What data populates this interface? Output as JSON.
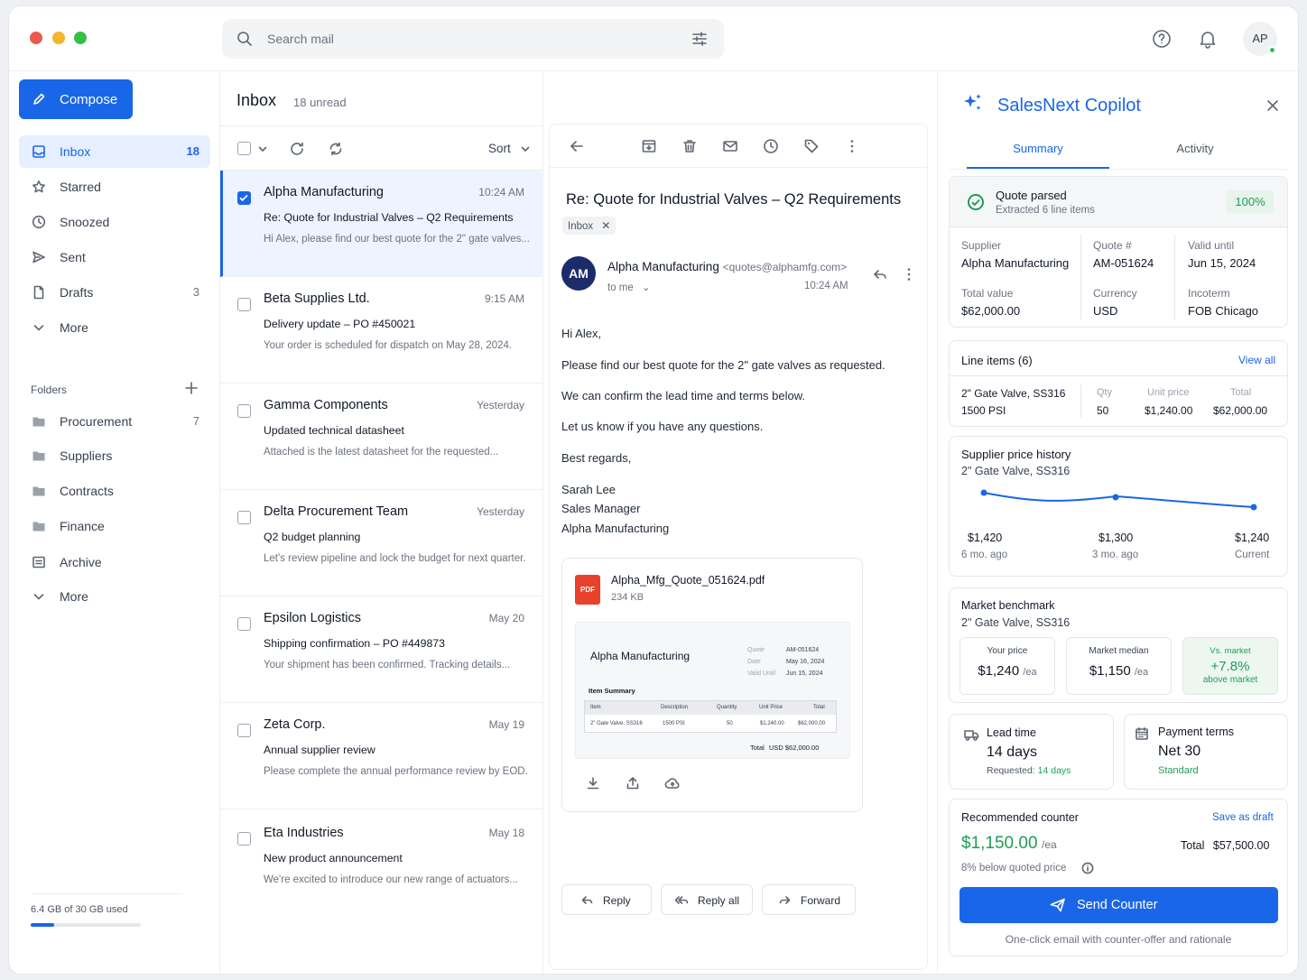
{
  "search": {
    "placeholder": "Search mail"
  },
  "user": {
    "initials": "AP"
  },
  "sidebar": {
    "compose": "Compose",
    "items": [
      {
        "label": "Inbox",
        "count": "18",
        "icon": "inbox-icon"
      },
      {
        "label": "Starred",
        "count": "",
        "icon": "star-icon"
      },
      {
        "label": "Snoozed",
        "count": "",
        "icon": "clock-icon"
      },
      {
        "label": "Sent",
        "count": "",
        "icon": "send-icon"
      },
      {
        "label": "Drafts",
        "count": "3",
        "icon": "file-icon"
      },
      {
        "label": "More",
        "count": "",
        "icon": "chevron-down-icon"
      }
    ],
    "folders_title": "Folders",
    "folders": [
      {
        "label": "Procurement",
        "count": "7"
      },
      {
        "label": "Suppliers",
        "count": ""
      },
      {
        "label": "Contracts",
        "count": ""
      },
      {
        "label": "Finance",
        "count": ""
      },
      {
        "label": "Archive",
        "count": ""
      },
      {
        "label": "More",
        "count": ""
      }
    ],
    "storage": {
      "text": "6.4 GB of 30 GB used",
      "fraction": 0.213
    }
  },
  "inbox": {
    "title": "Inbox",
    "unread": "18 unread",
    "sort": "Sort",
    "messages": [
      {
        "from": "Alpha Manufacturing",
        "time": "10:24 AM",
        "subject": "Re: Quote for Industrial Valves – Q2 Requirements",
        "preview": "Hi Alex, please find our best quote for the 2\" gate valves...",
        "selected": true
      },
      {
        "from": "Beta Supplies Ltd.",
        "time": "9:15 AM",
        "subject": "Delivery update – PO #450021",
        "preview": "Your order is scheduled for dispatch on May 28, 2024."
      },
      {
        "from": "Gamma Components",
        "time": "Yesterday",
        "subject": "Updated technical datasheet",
        "preview": "Attached is the latest datasheet for the requested..."
      },
      {
        "from": "Delta Procurement Team",
        "time": "Yesterday",
        "subject": "Q2 budget planning",
        "preview": "Let's review pipeline and lock the budget for next quarter."
      },
      {
        "from": "Epsilon Logistics",
        "time": "May 20",
        "subject": "Shipping confirmation – PO #449873",
        "preview": "Your shipment has been confirmed. Tracking details..."
      },
      {
        "from": "Zeta Corp.",
        "time": "May 19",
        "subject": "Annual supplier review",
        "preview": "Please complete the annual performance review by EOD."
      },
      {
        "from": "Eta Industries",
        "time": "May 18",
        "subject": "New product announcement",
        "preview": "We're excited to introduce our new range of actuators..."
      }
    ]
  },
  "reader": {
    "subject": "Re: Quote for Industrial Valves – Q2 Requirements",
    "tag": "Inbox",
    "avatar": "AM",
    "sender": "Alpha Manufacturing",
    "email": "<quotes@alphamfg.com>",
    "to": "to me",
    "time": "10:24 AM",
    "body": [
      "Hi Alex,",
      "Please find our best quote for the 2\" gate valves as requested.",
      "We can confirm the lead time and terms below.",
      "Let us know if you have any questions.",
      "Best regards,",
      "Sarah Lee",
      "Sales Manager",
      "Alpha Manufacturing"
    ],
    "attachment": {
      "name": "Alpha_Mfg_Quote_051624.pdf",
      "size": "234 KB",
      "pdf_badge": "PDF",
      "preview": {
        "company": "Alpha Manufacturing",
        "meta": [
          [
            "Quote",
            "AM-051624"
          ],
          [
            "Date",
            "May 16, 2024"
          ],
          [
            "Valid Until",
            "Jun 15, 2024"
          ]
        ],
        "section": "Item Summary",
        "headers": [
          "Item",
          "Description",
          "Quantity",
          "Unit Price",
          "Total"
        ],
        "row": [
          "2\" Gate Valve, SS316",
          "1500 PSI",
          "50",
          "$1,240.00",
          "$62,000.00"
        ],
        "total_label": "Total",
        "total": "USD $62,000.00"
      }
    },
    "actions": {
      "reply": "Reply",
      "reply_all": "Reply all",
      "forward": "Forward"
    }
  },
  "copilot": {
    "title": "SalesNext Copilot",
    "tabs": [
      "Summary",
      "Activity"
    ],
    "status": {
      "title": "Quote parsed",
      "sub": "Extracted 6 line items",
      "pct": "100%"
    },
    "fields": [
      {
        "label": "Supplier",
        "value": "Alpha Manufacturing"
      },
      {
        "label": "Quote #",
        "value": "AM-051624"
      },
      {
        "label": "Valid until",
        "value": "Jun 15, 2024"
      },
      {
        "label": "Total value",
        "value": "$62,000.00"
      },
      {
        "label": "Currency",
        "value": "USD"
      },
      {
        "label": "Incoterm",
        "value": "FOB Chicago"
      }
    ],
    "line_items": {
      "title": "Line items (6)",
      "view_all": "View all",
      "item": "2\" Gate Valve, SS316",
      "spec": "1500 PSI",
      "qty_label": "Qty",
      "qty": "50",
      "unit_label": "Unit price",
      "unit": "$1,240.00",
      "total_label": "Total",
      "total": "$62,000.00"
    },
    "price_history": {
      "title": "Supplier price history",
      "sub": "2\" Gate Valve, SS316",
      "points": [
        {
          "value": "$1,420",
          "label": "6 mo. ago"
        },
        {
          "value": "$1,300",
          "label": "3 mo. ago"
        },
        {
          "value": "$1,240",
          "label": "Current"
        }
      ]
    },
    "benchmark": {
      "title": "Market benchmark",
      "sub": "2\" Gate Valve, SS316",
      "your_label": "Your price",
      "your": "$1,240",
      "unit": "/ea",
      "median_label": "Market median",
      "median": "$1,150",
      "vs_label": "Vs. market",
      "vs": "+7.8%",
      "vs_sub": "above market"
    },
    "lead": {
      "title": "Lead time",
      "value": "14 days",
      "req_label": "Requested:",
      "req": "14 days"
    },
    "payment": {
      "title": "Payment terms",
      "value": "Net 30",
      "sub": "Standard"
    },
    "counter": {
      "title": "Recommended counter",
      "save": "Save as draft",
      "price": "$1,150.00",
      "unit": "/ea",
      "total_label": "Total",
      "total": "$57,500.00",
      "note": "8% below quoted price",
      "send": "Send Counter",
      "footer": "One-click email with counter-offer and rationale"
    }
  },
  "colors": {
    "accent": "#1a66e8",
    "green": "#1f9d55",
    "pdf": "#e8412c"
  }
}
